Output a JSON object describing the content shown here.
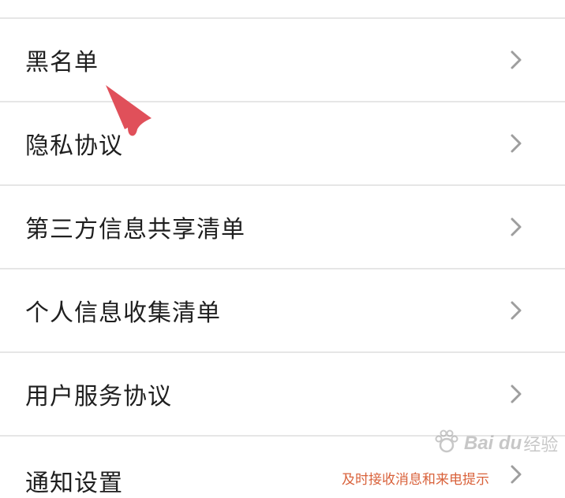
{
  "settings_menu": {
    "items": [
      {
        "label": "黑名单",
        "hint": ""
      },
      {
        "label": "隐私协议",
        "hint": ""
      },
      {
        "label": "第三方信息共享清单",
        "hint": ""
      },
      {
        "label": "个人信息收集清单",
        "hint": ""
      },
      {
        "label": "用户服务协议",
        "hint": ""
      },
      {
        "label": "通知设置",
        "hint": "及时接收消息和来电提示"
      }
    ],
    "chevron_icon": "chevron-right-icon"
  },
  "overlay": {
    "pointer_icon": "red-arrow-pointer-icon",
    "pointer_color": "#e0505a",
    "watermark": {
      "brand": "Bai du",
      "suffix": "经验",
      "icon": "paw-icon"
    }
  },
  "colors": {
    "divider": "#e6e6e6",
    "text": "#1f1f1f",
    "chevron": "#9e9e9e",
    "hint": "#d9623b"
  }
}
